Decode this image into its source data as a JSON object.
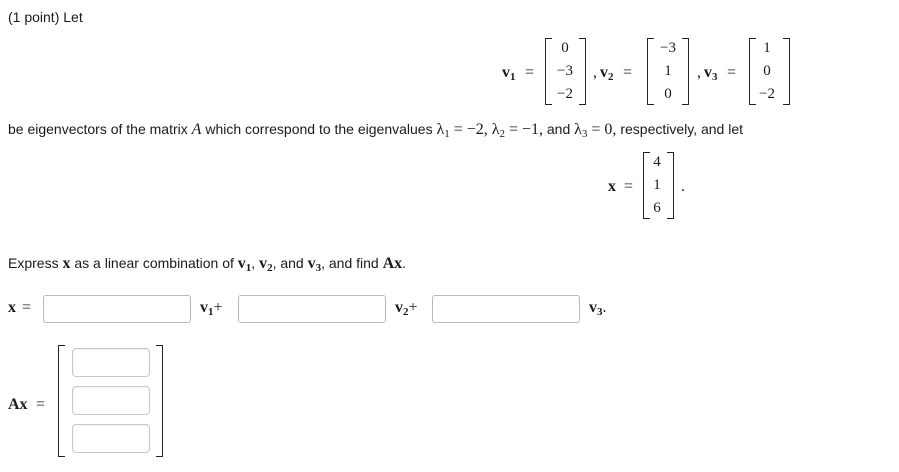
{
  "problem": {
    "points_label": "(1 point) Let",
    "sentence_prefix": "be eigenvectors of the matrix",
    "matrix_symbol": "A",
    "sentence_mid": "which correspond to the eigenvalues",
    "lambda1": "λ",
    "lambda1_sub": "1",
    "lambda1_val": " = −2,",
    "lambda2": "λ",
    "lambda2_sub": "2",
    "lambda2_val": " = −1,",
    "and_word": "and",
    "lambda3": "λ",
    "lambda3_sub": "3",
    "lambda3_val": " = 0,",
    "sentence_suffix": "respectively, and let",
    "express_text": "Express",
    "express_x": "x",
    "express_mid": "as a linear combination of",
    "express_v1": "v",
    "express_v1_sub": "1",
    "express_comma1": ",",
    "express_v2": "v",
    "express_v2_sub": "2",
    "express_and": ", and",
    "express_v3": "v",
    "express_v3_sub": "3",
    "express_find": ", and find",
    "express_Ax": "Ax",
    "express_period": "."
  },
  "vectors": {
    "v1": {
      "label": "v",
      "sub": "1",
      "eq": "=",
      "entries": [
        "0",
        "−3",
        "−2"
      ]
    },
    "v2": {
      "label": "v",
      "sub": "2",
      "eq": "=",
      "entries": [
        "−3",
        "1",
        "0"
      ]
    },
    "v3": {
      "label": "v",
      "sub": "3",
      "eq": "=",
      "entries": [
        "1",
        "0",
        "−2"
      ]
    },
    "sep1": ",",
    "sep2": ","
  },
  "xvec": {
    "label": "x",
    "eq": "=",
    "entries": [
      "4",
      "1",
      "6"
    ],
    "period": "."
  },
  "answer": {
    "x_label": "x",
    "x_eq": "=",
    "v1": "v",
    "v1_sub": "1",
    "plus1": "+",
    "v2": "v",
    "v2_sub": "2",
    "plus2": "+",
    "v3": "v",
    "v3_sub": "3",
    "period": ".",
    "coef1_value": "",
    "coef2_value": "",
    "coef3_value": "",
    "Ax_label": "Ax",
    "Ax_eq": "=",
    "Ax_values": [
      "",
      "",
      ""
    ]
  }
}
